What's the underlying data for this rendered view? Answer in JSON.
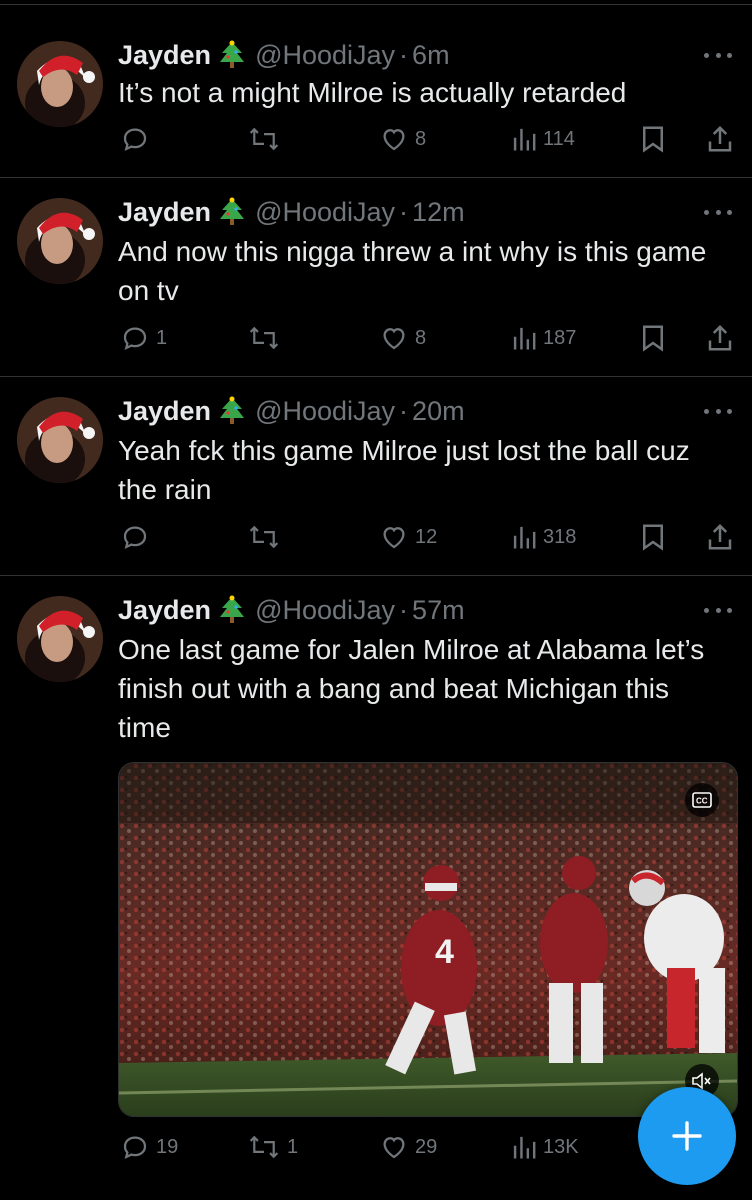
{
  "colors": {
    "background": "#000000",
    "text": "#e7e9ea",
    "muted": "#71767b",
    "divider": "#2f3336",
    "accent": "#1d9bf0"
  },
  "tweets": [
    {
      "name": "Jayden",
      "name_emoji": "christmas-tree-icon",
      "handle": "@HoodiJay",
      "separator": "·",
      "time": "6m",
      "text": "It’s not a might Milroe is actually retarded",
      "replies": "",
      "retweets": "",
      "likes": "8",
      "views": "114"
    },
    {
      "name": "Jayden",
      "name_emoji": "christmas-tree-icon",
      "handle": "@HoodiJay",
      "separator": "·",
      "time": "12m",
      "text": "And now this nigga threw a int why is this game on tv",
      "replies": "1",
      "retweets": "",
      "likes": "8",
      "views": "187"
    },
    {
      "name": "Jayden",
      "name_emoji": "christmas-tree-icon",
      "handle": "@HoodiJay",
      "separator": "·",
      "time": "20m",
      "text": "Yeah fck this game Milroe just lost the ball cuz the rain",
      "replies": "",
      "retweets": "",
      "likes": "12",
      "views": "318"
    },
    {
      "name": "Jayden",
      "name_emoji": "christmas-tree-icon",
      "handle": "@HoodiJay",
      "separator": "·",
      "time": "57m",
      "text": "One last game for Jalen Milroe at Alabama let’s finish out with a bang and beat Michigan this time",
      "replies": "19",
      "retweets": "1",
      "likes": "29",
      "views": "13K",
      "media": {
        "type": "video",
        "caption_icon": "closed-captions-icon",
        "mute_icon": "muted-speaker-icon",
        "jersey_number": "4"
      }
    }
  ],
  "compose_button": {
    "icon": "plus-icon"
  }
}
